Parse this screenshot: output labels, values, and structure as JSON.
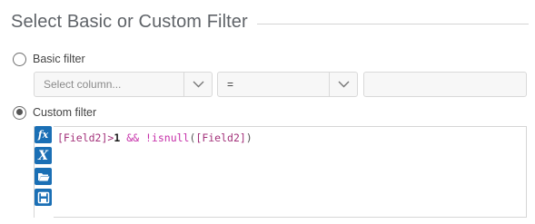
{
  "section": {
    "title": "Select Basic or Custom Filter"
  },
  "basic": {
    "label": "Basic filter",
    "checked": false,
    "column_placeholder": "Select column...",
    "operator_value": "=",
    "value_input": ""
  },
  "custom": {
    "label": "Custom filter",
    "checked": true
  },
  "toolbar": {
    "items": [
      "function-icon",
      "variable-icon",
      "open-folder-icon",
      "save-icon"
    ],
    "function_glyph": "fx",
    "variable_glyph": "X"
  },
  "expression": {
    "tokens": [
      {
        "text": "[Field2]",
        "kind": "field"
      },
      {
        "text": ">",
        "kind": "op"
      },
      {
        "text": "1",
        "kind": "num"
      },
      {
        "text": " ",
        "kind": "punc"
      },
      {
        "text": "&&",
        "kind": "logic"
      },
      {
        "text": " ",
        "kind": "punc"
      },
      {
        "text": "!isnull",
        "kind": "logic"
      },
      {
        "text": "(",
        "kind": "fn"
      },
      {
        "text": "[Field2]",
        "kind": "field"
      },
      {
        "text": ")",
        "kind": "fn"
      }
    ]
  },
  "colors": {
    "accent": "#1a6fb5",
    "field": "#a3317a",
    "logic": "#c62fa9"
  }
}
